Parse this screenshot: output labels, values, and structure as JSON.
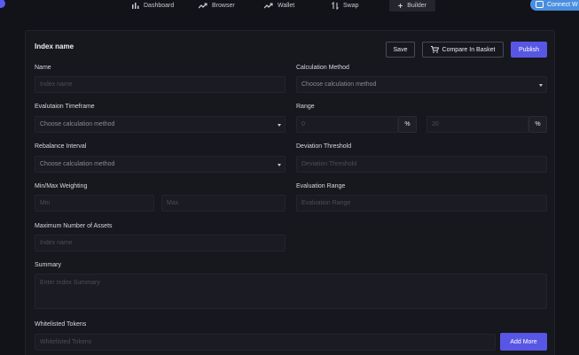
{
  "nav": {
    "items": [
      {
        "label": "Dashboard",
        "icon": "bar-chart-icon"
      },
      {
        "label": "Browser",
        "icon": "trend-icon"
      },
      {
        "label": "Wallet",
        "icon": "trend-icon"
      },
      {
        "label": "Swap",
        "icon": "swap-icon"
      },
      {
        "label": "Builder",
        "icon": "plus-icon",
        "active": true
      }
    ],
    "connect_label": "Connect W"
  },
  "form": {
    "title": "Index name",
    "buttons": {
      "save": "Save",
      "compare": "Compare In Basket",
      "publish": "Publish",
      "add_more": "Add More"
    },
    "name": {
      "label": "Name",
      "placeholder": "Index name"
    },
    "calc_method": {
      "label": "Calculation Method",
      "value": "Choose calculation method"
    },
    "eval_timeframe": {
      "label": "Evalutaion Timeframe",
      "value": "Choose calculation method"
    },
    "range": {
      "label": "Range",
      "min": "0",
      "max": "20",
      "unit": "%"
    },
    "rebalance": {
      "label": "Rebalance Interval",
      "value": "Choose calculation method"
    },
    "deviation": {
      "label": "Deviation Threshold",
      "placeholder": "Deviation Threshold"
    },
    "minmax": {
      "label": "Min/Max Weighting",
      "min": "Min",
      "max": "Max"
    },
    "eval_range": {
      "label": "Evaluation Range",
      "placeholder": "Evaluation Range"
    },
    "max_assets": {
      "label": "Maximum Number of Assets",
      "placeholder": "Index name"
    },
    "summary": {
      "label": "Summary",
      "placeholder": "Enter Index Summary"
    },
    "whitelist": {
      "label": "Whitelisted Tokens",
      "placeholder": "Whitelisted Tokens"
    }
  },
  "colors": {
    "accent": "#5856e5",
    "connect": "#4a8fdf",
    "background": "#121219",
    "panel": "#17171e"
  }
}
